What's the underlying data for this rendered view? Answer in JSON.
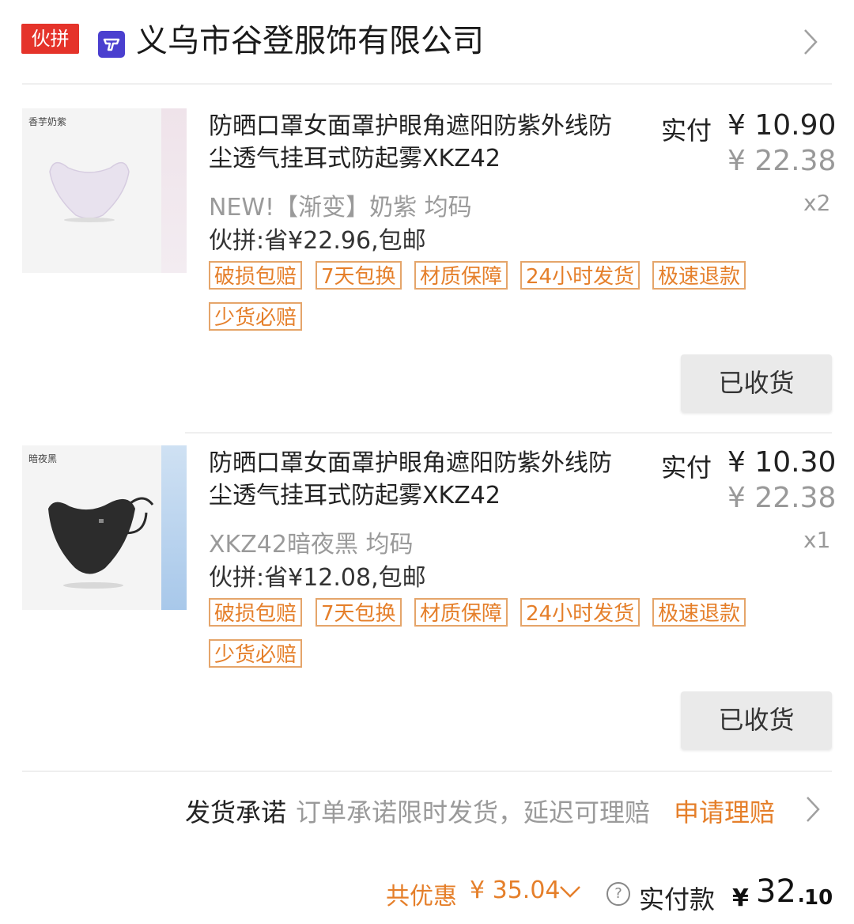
{
  "header": {
    "badge": "伙拼",
    "shop_name": "义乌市谷登服饰有限公司",
    "chevron": "chevron-right-icon"
  },
  "products": [
    {
      "thumb_tag": "香芋奶紫",
      "title_line1": "防晒口罩女面罩护眼角遮阳防紫外线防",
      "title_line2": "尘透气挂耳式防起雾XKZ42",
      "paid_label": "实付",
      "paid_price": "¥ 10.90",
      "original_price": "¥ 22.38",
      "variant": "NEW!【渐变】奶紫 均码",
      "quantity": "x2",
      "promo": "伙拼:省¥22.96,包邮",
      "tags": [
        "破损包赔",
        "7天包换",
        "材质保障",
        "24小时发货",
        "极速退款",
        "少货必赔"
      ],
      "action": "已收货"
    },
    {
      "thumb_tag": "暗夜黑",
      "title_line1": "防晒口罩女面罩护眼角遮阳防紫外线防",
      "title_line2": "尘透气挂耳式防起雾XKZ42",
      "paid_label": "实付",
      "paid_price": "¥ 10.30",
      "original_price": "¥ 22.38",
      "variant": "XKZ42暗夜黑 均码",
      "quantity": "x1",
      "promo": "伙拼:省¥12.08,包邮",
      "tags": [
        "破损包赔",
        "7天包换",
        "材质保障",
        "24小时发货",
        "极速退款",
        "少货必赔"
      ],
      "action": "已收货"
    }
  ],
  "promise": {
    "label": "发货承诺",
    "text": "订单承诺限时发货，延迟可理赔",
    "link": "申请理赔"
  },
  "summary": {
    "discount_label": "共优惠",
    "discount_value": "¥ 35.04",
    "total_label": "实付款",
    "currency": "¥",
    "total_integer": "32.",
    "total_decimal": "10"
  },
  "colors": {
    "badge": "#e5332a",
    "accent_orange": "#e57f2a",
    "shop_logo": "#4a3fcf"
  }
}
